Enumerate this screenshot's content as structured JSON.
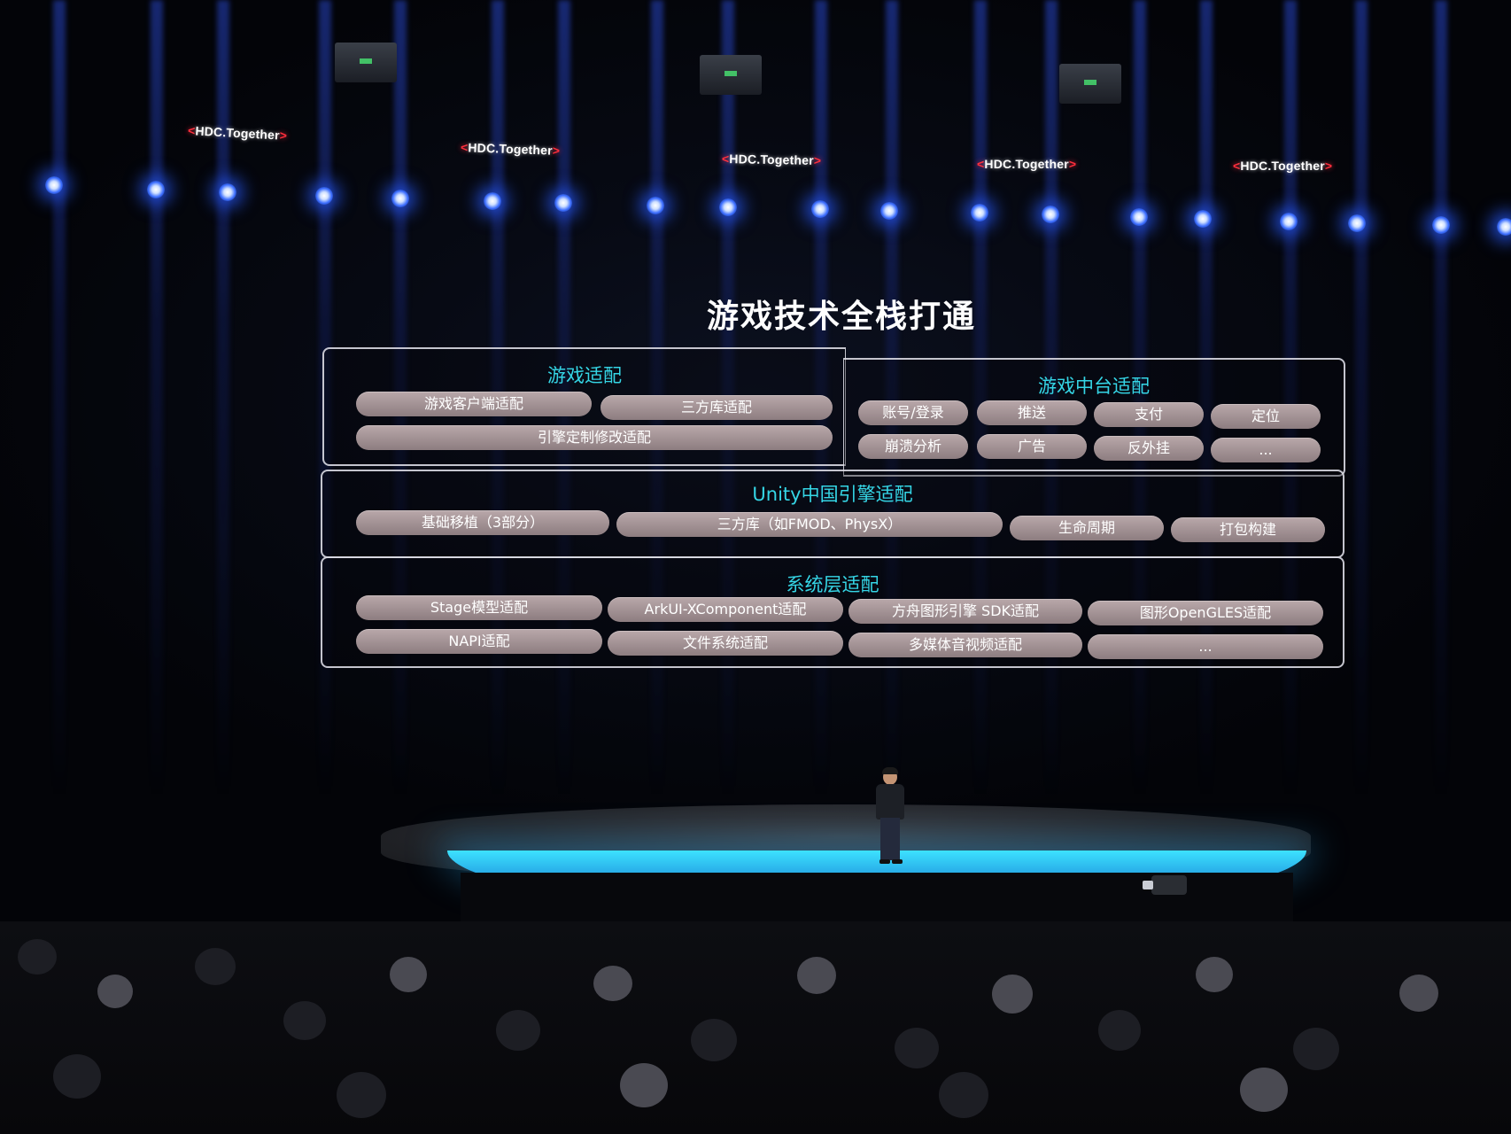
{
  "event_signs": [
    {
      "left": "<",
      "text": "HDC.Together",
      "right": ">"
    },
    {
      "left": "<",
      "text": "HDC.Together",
      "right": ">"
    },
    {
      "left": "<",
      "text": "HDC.Together",
      "right": ">"
    },
    {
      "left": "<",
      "text": "HDC.Together",
      "right": ">"
    },
    {
      "left": "<",
      "text": "HDC.Together",
      "right": ">"
    }
  ],
  "slide": {
    "title": "游戏技术全栈打通",
    "game_adaptation": {
      "title": "游戏适配",
      "items": [
        "游戏客户端适配",
        "三方库适配",
        "引擎定制修改适配"
      ]
    },
    "game_platform_adaptation": {
      "title": "游戏中台适配",
      "items": [
        "账号/登录",
        "推送",
        "支付",
        "定位",
        "崩溃分析",
        "广告",
        "反外挂",
        "..."
      ]
    },
    "unity_adaptation": {
      "title": "Unity中国引擎适配",
      "items": [
        "基础移植（3部分）",
        "三方库（如FMOD、PhysX）",
        "生命周期",
        "打包构建"
      ]
    },
    "system_layer_adaptation": {
      "title": "系统层适配",
      "items": [
        "Stage模型适配",
        "ArkUI-XComponent适配",
        "方舟图形引擎 SDK适配",
        "图形OpenGLES适配",
        "NAPI适配",
        "文件系统适配",
        "多媒体音视频适配",
        "..."
      ]
    }
  },
  "colors": {
    "panel_title": "#35d6e6",
    "pill": "#a89799",
    "spotlight": "#3a6cff",
    "sign_bracket": "#ff2e3c",
    "stage_rim": "#3de2ff"
  }
}
